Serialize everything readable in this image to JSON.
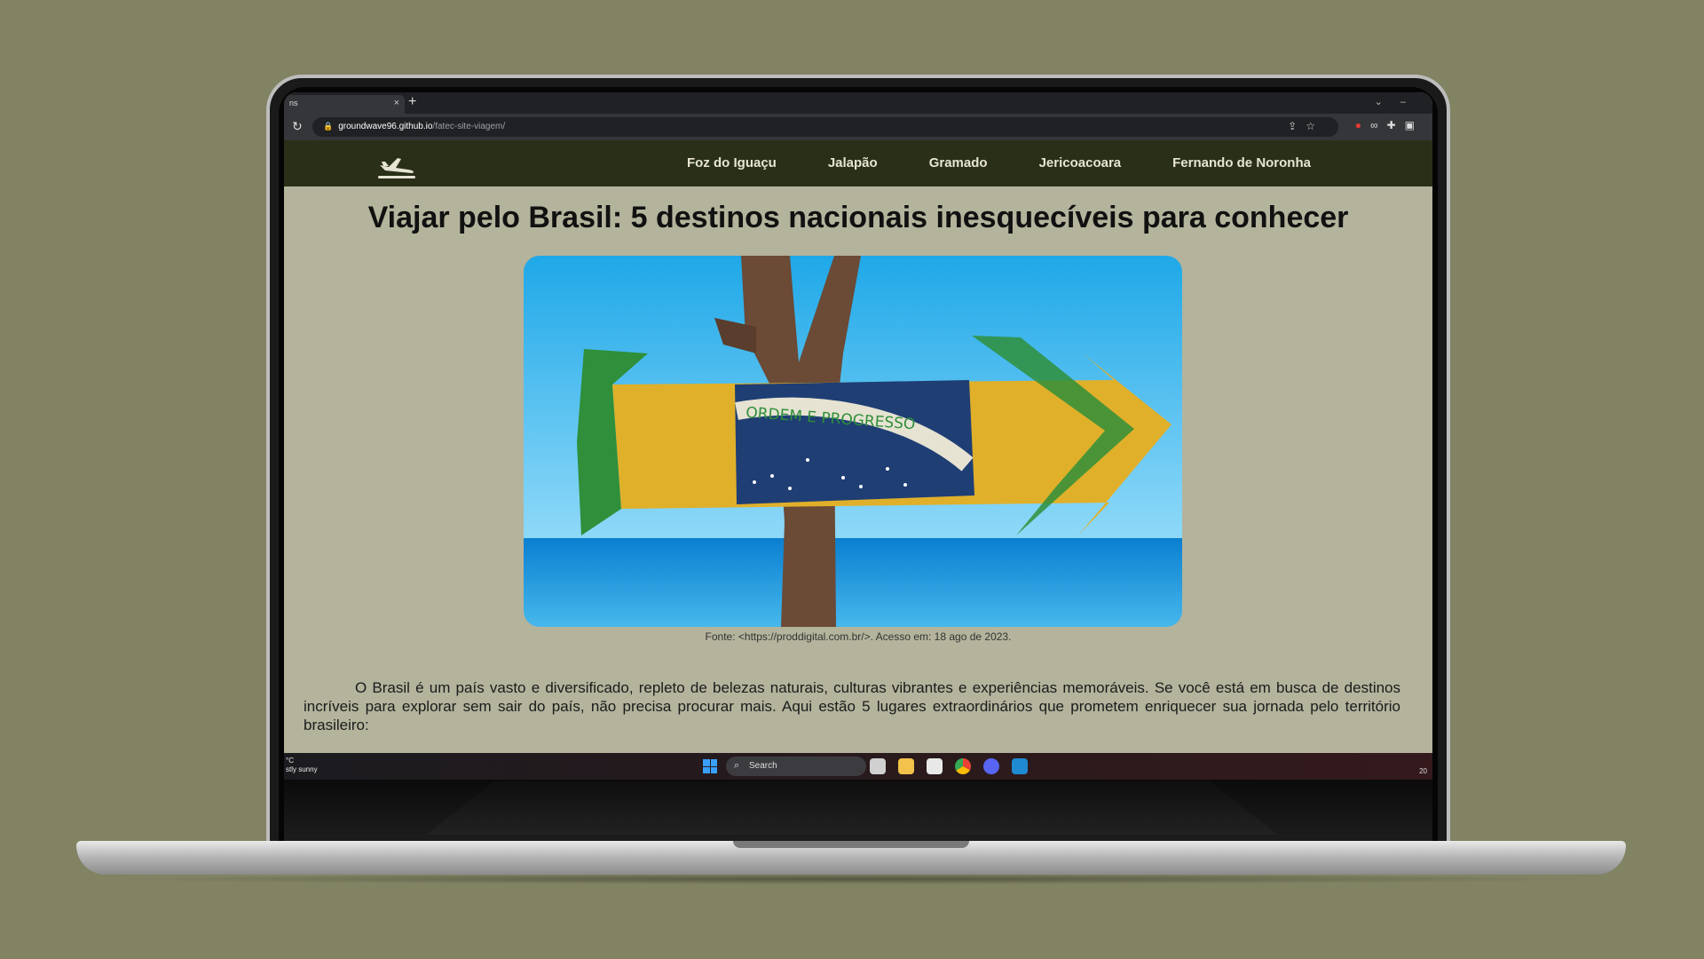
{
  "browser": {
    "tab_title": "ns",
    "tab_close": "×",
    "new_tab": "+",
    "url_host": "groundwave96.github.io",
    "url_path": "/fatec-site-viagem/"
  },
  "site": {
    "nav": [
      "Foz do Iguaçu",
      "Jalapão",
      "Gramado",
      "Jericoacoara",
      "Fernando de Noronha"
    ],
    "title": "Viajar pelo Brasil: 5 destinos nacionais inesquecíveis para conhecer",
    "image_banner": "ORDEM E PROGRESSO",
    "caption": "Fonte: <https://proddigital.com.br/>. Acesso em: 18 ago de 2023.",
    "intro": "O Brasil é um país vasto e diversificado, repleto de belezas naturais, culturas vibrantes e experiências memoráveis. Se você está em busca de destinos incríveis para explorar sem sair do país, não precisa procurar mais. Aqui estão 5 lugares extraordinários que prometem enriquecer sua jornada pelo território brasileiro:"
  },
  "taskbar": {
    "weather_temp": "°C",
    "weather_desc": "stly sunny",
    "search_label": "Search",
    "clock": "20"
  }
}
